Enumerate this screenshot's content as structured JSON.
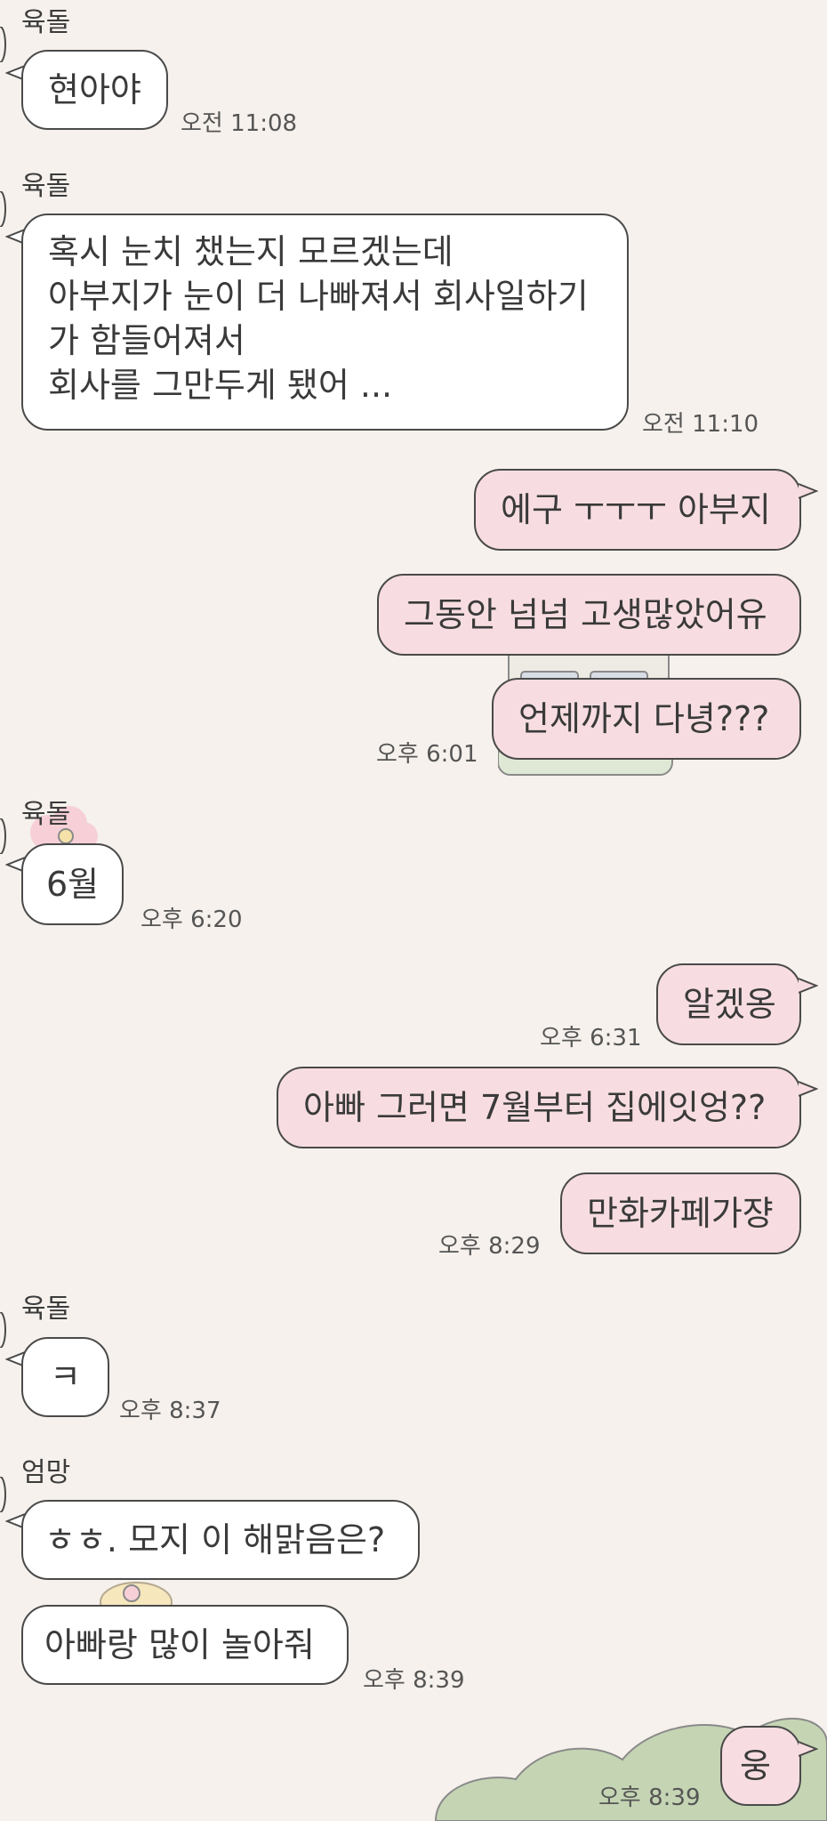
{
  "colors": {
    "background": "#f6f1ec",
    "incoming_bubble": "#ffffff",
    "outgoing_bubble": "#f7dde1",
    "bubble_border": "#4a4a4a",
    "sticker_green": "#c5d5b4",
    "sticker_pink": "#f3b9c6"
  },
  "chat": {
    "messages": [
      {
        "sender": "육돌",
        "text": "현아야",
        "time": "오전 11:08"
      },
      {
        "sender": "육돌",
        "text_lines": [
          "혹시 눈치 챘는지 모르겠는데",
          "아부지가 눈이 더 나빠져서 회사일하기",
          "가 함들어져서",
          "회사를 그만두게 됐어 ..."
        ],
        "time": "오전 11:10"
      },
      {
        "sender": "me",
        "text": "에구 ㅜㅜㅜ 아부지"
      },
      {
        "sender": "me",
        "text": "그동안 넘넘 고생많았어유"
      },
      {
        "sender": "me",
        "text": "언제까지 다녕???",
        "time": "오후 6:01"
      },
      {
        "sender": "육돌",
        "text": "6월",
        "time": "오후 6:20"
      },
      {
        "sender": "me",
        "text": "알겠옹",
        "time": "오후 6:31"
      },
      {
        "sender": "me",
        "text": "아빠 그러면 7월부터 집에잇엉??"
      },
      {
        "sender": "me",
        "text": "만화카페가쟝",
        "time": "오후 8:29"
      },
      {
        "sender": "육돌",
        "text": "ㅋ",
        "time": "오후 8:37"
      },
      {
        "sender": "엄망",
        "text": "ㅎㅎ. 모지 이 해맑음은?"
      },
      {
        "sender": "엄망",
        "text": "아빠랑 많이 놀아줘",
        "time": "오후 8:39"
      },
      {
        "sender": "me",
        "text": "웅",
        "time": "오후 8:39"
      }
    ]
  }
}
